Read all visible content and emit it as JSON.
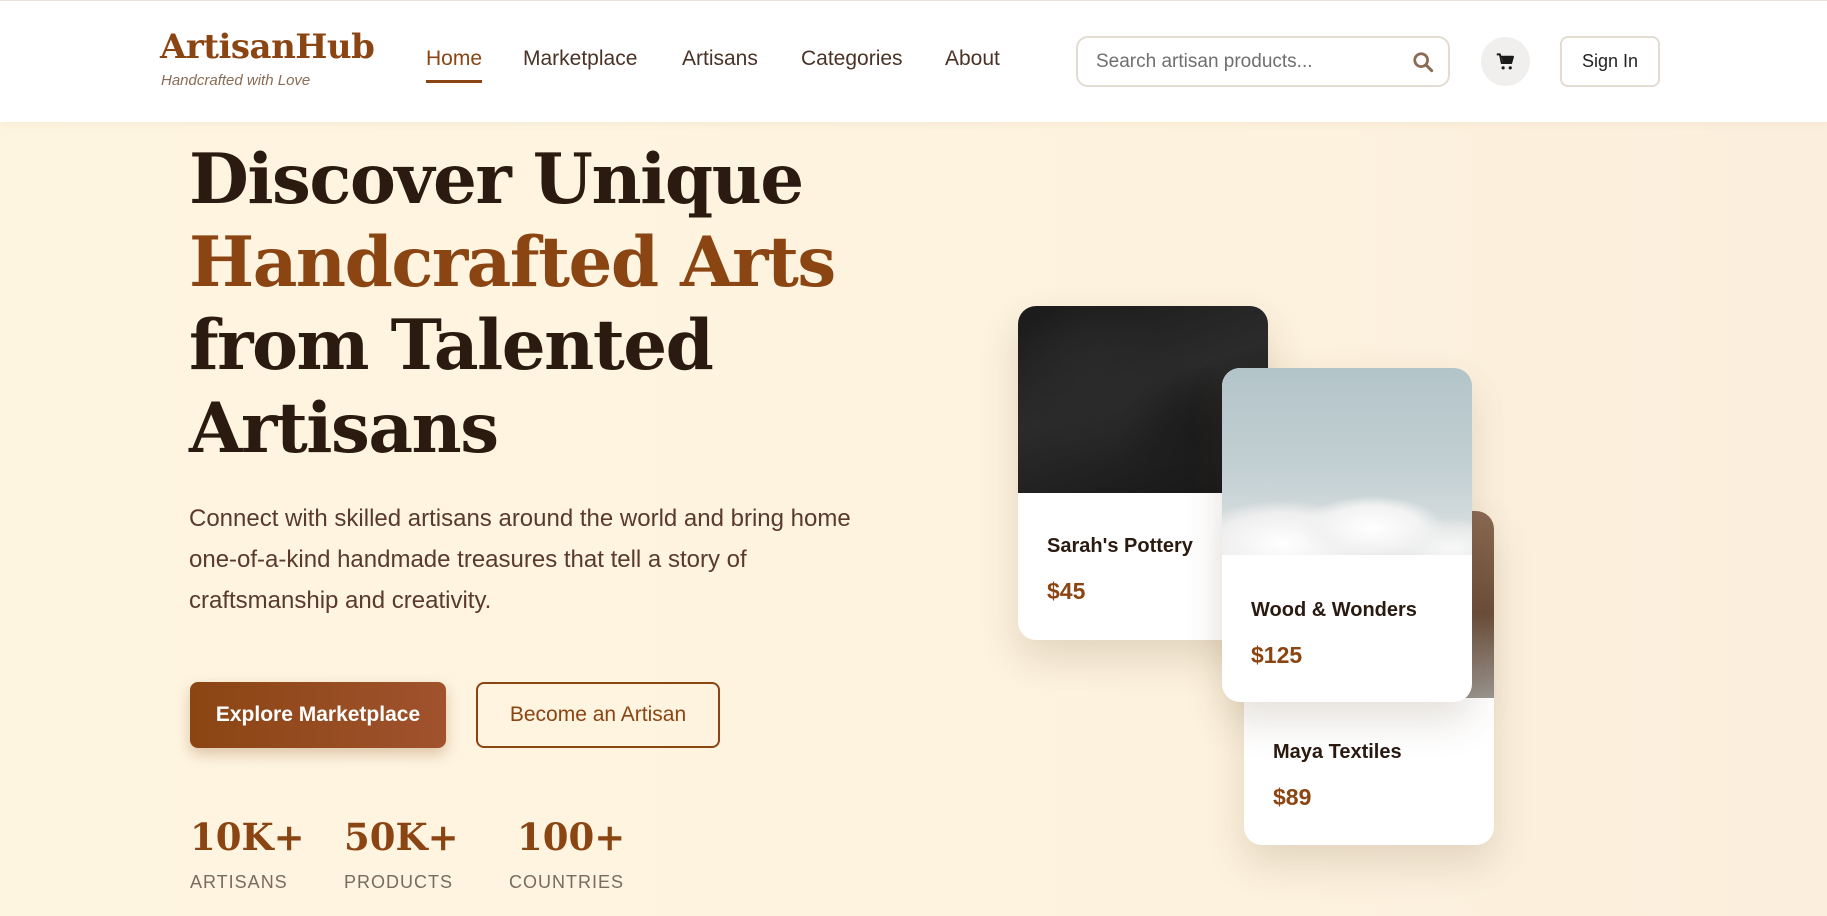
{
  "header": {
    "brand": "ArtisanHub",
    "tagline": "Handcrafted with Love",
    "nav": [
      {
        "label": "Home",
        "active": true
      },
      {
        "label": "Marketplace",
        "active": false
      },
      {
        "label": "Artisans",
        "active": false
      },
      {
        "label": "Categories",
        "active": false
      },
      {
        "label": "About",
        "active": false
      }
    ],
    "search_placeholder": "Search artisan products...",
    "search_icon": "search-icon",
    "cart_icon": "cart-icon",
    "sign_in": "Sign In"
  },
  "hero": {
    "title_line1": "Discover Unique",
    "title_line2": "Handcrafted Arts",
    "title_line3": "from Talented",
    "title_line4": "Artisans",
    "description": "Connect with skilled artisans around the world and bring home one-of-a-kind handmade treasures that tell a story of craftsmanship and creativity.",
    "primary_cta": "Explore Marketplace",
    "secondary_cta": "Become an Artisan"
  },
  "stats": [
    {
      "value": "10K+",
      "label": "ARTISANS"
    },
    {
      "value": "50K+",
      "label": "PRODUCTS"
    },
    {
      "value": "100+",
      "label": "COUNTRIES"
    }
  ],
  "cards": [
    {
      "name": "Sarah's Pottery",
      "price": "$45"
    },
    {
      "name": "Wood & Wonders",
      "price": "$125"
    },
    {
      "name": "Maya Textiles",
      "price": "$89"
    }
  ],
  "colors": {
    "accent": "#8b4513",
    "background": "#fdf3e0",
    "heading": "#2b1a10"
  }
}
